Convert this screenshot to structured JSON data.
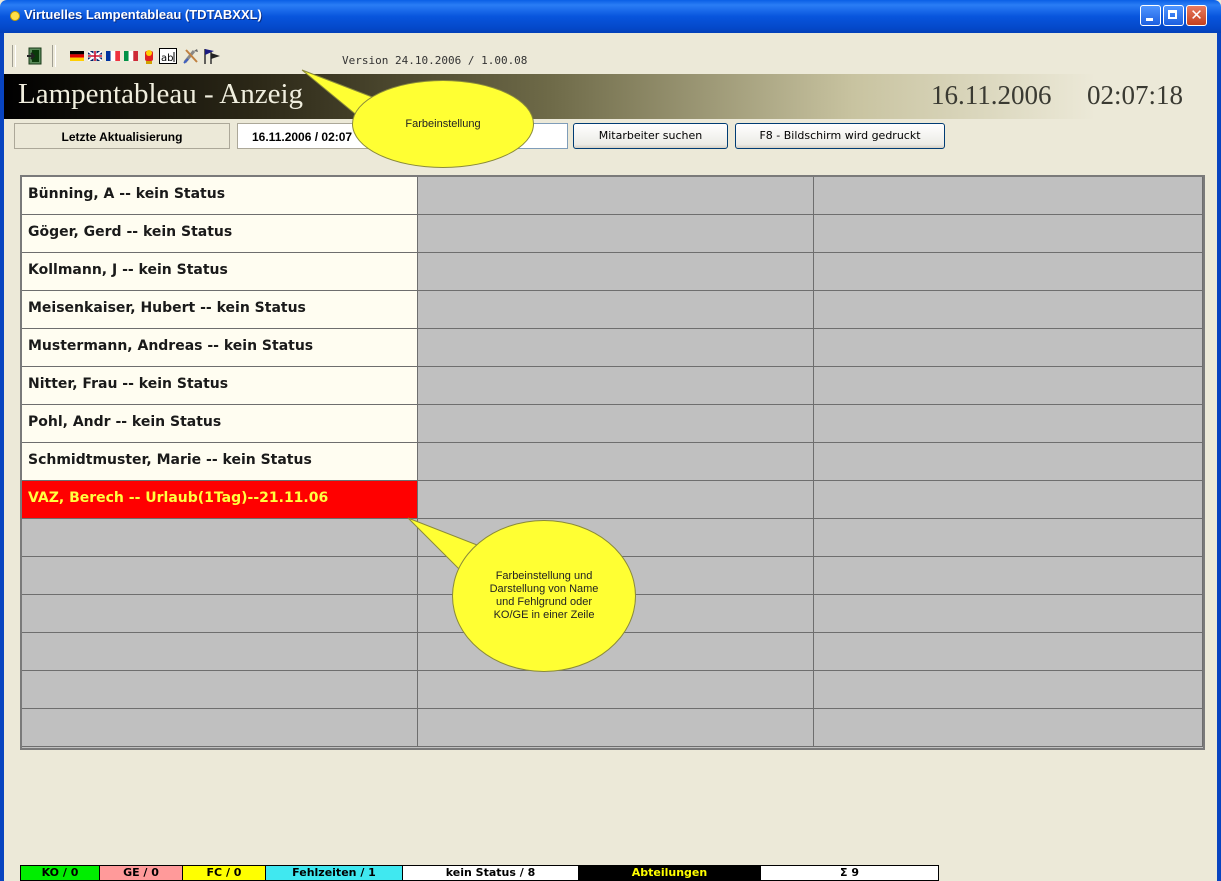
{
  "window": {
    "title": "Virtuelles Lampentableau (TDTABXXL)",
    "controls": {
      "minimize": "_",
      "maximize": "□",
      "close": "✕"
    }
  },
  "toolbar": {
    "version": "Version 24.10.2006 / 1.00.08",
    "icons": [
      "exit-icon",
      "flag-de-icon",
      "flag-uk-icon",
      "flag-fr-icon",
      "flag-it-icon",
      "lamp-icon",
      "text-ab-icon",
      "settings-tools-icon",
      "flags-icon"
    ]
  },
  "banner": {
    "title": "Lampentableau - Anzeig",
    "date": "16.11.2006",
    "time": "02:07:18"
  },
  "controls": {
    "last_update_label": "Letzte Aktualisierung",
    "last_update_value": "16.11.2006 / 02:07",
    "search_button": "Mitarbeiter suchen",
    "print_button": "F8 - Bildschirm wird gedruckt"
  },
  "employees": [
    {
      "text": "Bünning, A --  kein Status",
      "status": "none"
    },
    {
      "text": "Göger, Gerd --  kein Status",
      "status": "none"
    },
    {
      "text": "Kollmann, J --  kein Status",
      "status": "none"
    },
    {
      "text": "Meisenkaiser, Hubert --  kein Status",
      "status": "none"
    },
    {
      "text": "Mustermann, Andreas --  kein Status",
      "status": "none"
    },
    {
      "text": "Nitter, Frau --  kein Status",
      "status": "none"
    },
    {
      "text": "Pohl, Andr --  kein Status",
      "status": "none"
    },
    {
      "text": "Schmidtmuster, Marie --  kein Status",
      "status": "none"
    },
    {
      "text": "VAZ, Berech --  Urlaub(1Tag)--21.11.06",
      "status": "absence"
    }
  ],
  "grid": {
    "rows": 15,
    "columns": 3
  },
  "callouts": {
    "top": "Farbeinstellung",
    "middle": "Farbeinstellung und Darstellung von Name und Fehlgrund oder KO/GE in einer Zeile"
  },
  "statusbar": [
    {
      "label": "KO  /  0",
      "bg": "#00ee00",
      "fg": "#000000"
    },
    {
      "label": "GE  /  0",
      "bg": "#ff9a9a",
      "fg": "#000000"
    },
    {
      "label": "FC  /  0",
      "bg": "#ffff00",
      "fg": "#000000"
    },
    {
      "label": "Fehlzeiten / 1",
      "bg": "#40e8f0",
      "fg": "#000000"
    },
    {
      "label": "kein Status / 8",
      "bg": "#ffffff",
      "fg": "#000000"
    },
    {
      "label": "Abteilungen",
      "bg": "#000000",
      "fg": "#ffff00"
    },
    {
      "label": "Σ 9",
      "bg": "#ffffff",
      "fg": "#000000"
    }
  ],
  "colors": {
    "name_cell": "#fffdf1",
    "empty_cell": "#c0c0c0",
    "alert_cell": "#ff0000",
    "alert_text": "#ffff40",
    "callout": "#ffff33"
  }
}
